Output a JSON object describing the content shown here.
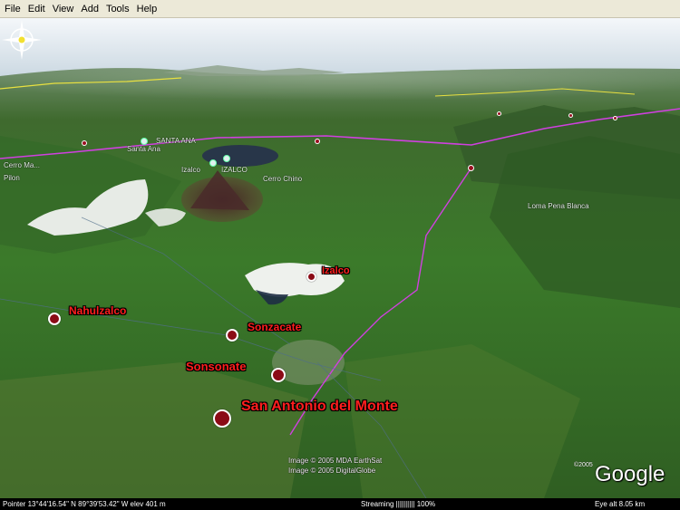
{
  "menu": [
    "File",
    "Edit",
    "View",
    "Add",
    "Tools",
    "Help"
  ],
  "places": {
    "nahuizalco": "Nahulzalco",
    "izalco": "Izalco",
    "sonzacate": "Sonzacate",
    "sonsonate": "Sonsonate",
    "san_antonio": "San Antonio del Monte"
  },
  "terrain_labels": {
    "santa_ana_caps": "SANTA ANA",
    "santa_ana": "Santa Ana",
    "izalco_caps": "IZALCO",
    "izalco_small": "Izalco",
    "cerro_chino": "Cerro Chino",
    "loma_pena_blanca": "Loma Pena Blanca",
    "cerro_la_left": "Cerro Ma...",
    "pilon": "Pilon"
  },
  "copyright": {
    "line1": "Image © 2005 MDA EarthSat",
    "line2": "Image © 2005 DigitalGlobe",
    "logo_year": "©2005",
    "logo": "Google"
  },
  "status": {
    "pointer": "Pointer  13°44'16.54\" N   89°39'53.42\" W   elev  401 m",
    "streaming": "Streaming |||||||||| 100%",
    "eye_alt": "Eye  alt    8.05 km"
  },
  "colors": {
    "pin": "#8b0b16",
    "label": "#ff1e1e",
    "border_line": "#d040e0",
    "road_line": "#e8e040"
  },
  "icons": {
    "compass": "compass-rose-icon",
    "volcano": "volcano-icon"
  }
}
